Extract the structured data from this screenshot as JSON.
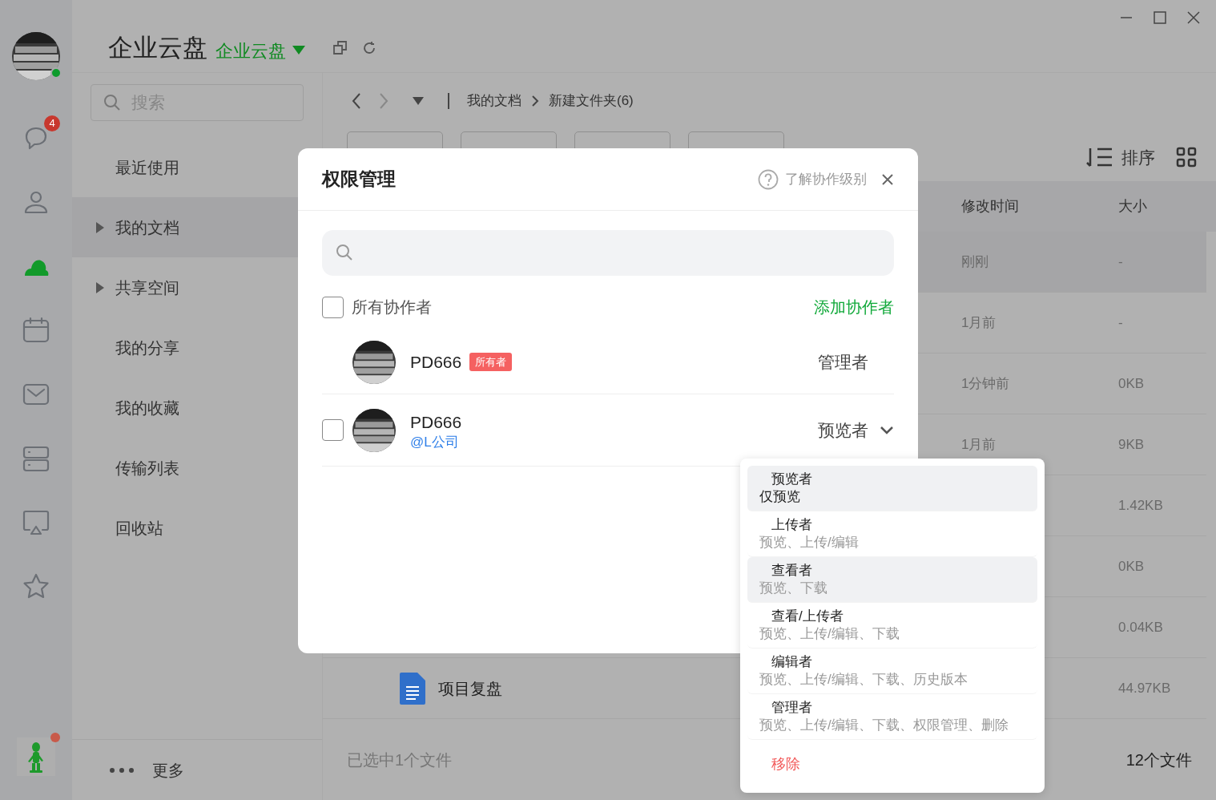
{
  "app": {
    "title": "企业云盘",
    "workspace": "企业云盘"
  },
  "rail": [
    {
      "kind": "chat",
      "badge": "4",
      "selected": false
    },
    {
      "kind": "person",
      "selected": false
    },
    {
      "kind": "cloud",
      "selected": true
    },
    {
      "kind": "calendar",
      "selected": false
    },
    {
      "kind": "mail",
      "selected": false
    },
    {
      "kind": "server",
      "selected": false
    },
    {
      "kind": "screen",
      "selected": false
    },
    {
      "kind": "star",
      "selected": false
    }
  ],
  "sidebar": {
    "search_placeholder": "搜索",
    "items": [
      {
        "label": "最近使用",
        "expandable": false,
        "selected": false
      },
      {
        "label": "我的文档",
        "expandable": true,
        "selected": true
      },
      {
        "label": "共享空间",
        "expandable": true,
        "selected": false
      },
      {
        "label": "我的分享",
        "expandable": false,
        "selected": false
      },
      {
        "label": "我的收藏",
        "expandable": false,
        "selected": false
      },
      {
        "label": "传输列表",
        "expandable": false,
        "selected": false
      },
      {
        "label": "回收站",
        "expandable": false,
        "selected": false
      }
    ],
    "more": "更多"
  },
  "breadcrumb": [
    "我的文档",
    "新建文件夹(6)"
  ],
  "toolbar": {
    "sort": "排序"
  },
  "table": {
    "columns": [
      "修改时间",
      "大小"
    ],
    "rows": [
      {
        "time": "刚刚",
        "size": "-",
        "selected": true
      },
      {
        "time": "1月前",
        "size": "-",
        "selected": false
      },
      {
        "time": "1分钟前",
        "size": "0KB",
        "selected": false
      },
      {
        "time": "1月前",
        "size": "9KB",
        "selected": false
      },
      {
        "size": "1.42KB",
        "selected": false
      },
      {
        "size": "0KB",
        "selected": false
      },
      {
        "size": "0.04KB",
        "selected": false
      },
      {
        "name": "项目复盘",
        "size": "44.97KB",
        "selected": false
      }
    ]
  },
  "status_bar": {
    "selection": "已选中1个文件",
    "count": "12个文件"
  },
  "dialog": {
    "title": "权限管理",
    "help": "了解协作级别",
    "all_label": "所有协作者",
    "all_checked": false,
    "add": "添加协作者",
    "members": [
      {
        "kind": "owner",
        "name": "PD666",
        "badge": "所有者",
        "role": "管理者"
      },
      {
        "kind": "member",
        "name": "PD666",
        "org": "@L公司",
        "role": "预览者",
        "checked": false,
        "expanded": true
      }
    ]
  },
  "role_menu": {
    "options": [
      {
        "title": "预览者",
        "desc": "仅预览",
        "highlighted": true
      },
      {
        "title": "上传者",
        "desc": "预览、上传/编辑",
        "highlighted": false
      },
      {
        "title": "查看者",
        "desc": "预览、下载",
        "highlighted": true
      },
      {
        "title": "查看/上传者",
        "desc": "预览、上传/编辑、下载",
        "highlighted": false
      },
      {
        "title": "编辑者",
        "desc": "预览、上传/编辑、下载、历史版本",
        "highlighted": false
      },
      {
        "title": "管理者",
        "desc": "预览、上传/编辑、下载、权限管理、删除",
        "highlighted": false
      }
    ],
    "remove": "移除"
  }
}
